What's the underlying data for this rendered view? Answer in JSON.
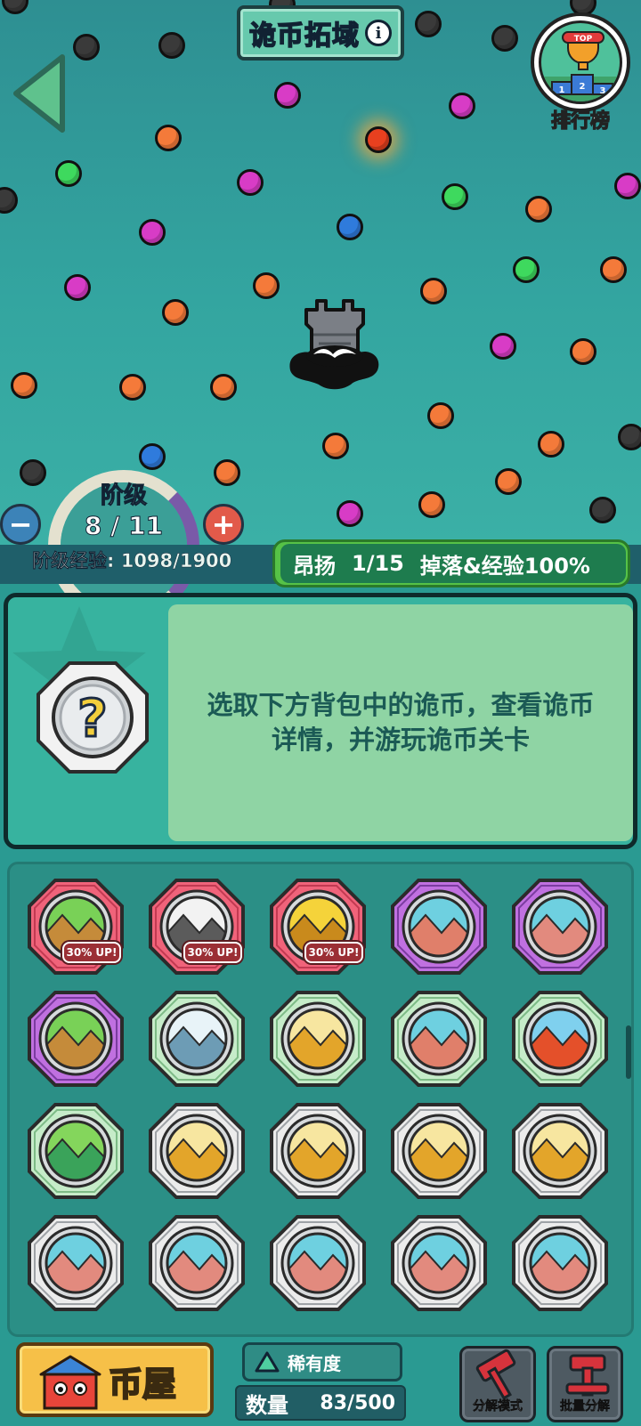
{
  "header": {
    "title": "诡币拓域",
    "info_icon": "info-icon"
  },
  "leaderboard": {
    "label": "排行榜",
    "badge_text": "TOP",
    "podium": [
      "1",
      "2",
      "3"
    ]
  },
  "stage": {
    "label": "阶级",
    "value": "8 / 11",
    "current": 8,
    "max": 11
  },
  "experience": {
    "text": "阶级经验: 1098/1900"
  },
  "status": {
    "name": "昂扬",
    "progress": "1/15",
    "bonus": "掉落&经验100%"
  },
  "detail": {
    "hint": "选取下方背包中的诡币，查看诡币详情，并游玩诡币关卡"
  },
  "inventory": {
    "up_tag": "30% UP!",
    "coins": [
      {
        "frame": "red",
        "theme": "scarecrow",
        "tag": true
      },
      {
        "frame": "red",
        "theme": "snow-pylon",
        "tag": true
      },
      {
        "frame": "red",
        "theme": "temple-gold",
        "tag": true
      },
      {
        "frame": "purple",
        "theme": "castle-tower",
        "tag": false
      },
      {
        "frame": "purple",
        "theme": "wall-ruins",
        "tag": false
      },
      {
        "frame": "purple",
        "theme": "scarecrow",
        "tag": false
      },
      {
        "frame": "green",
        "theme": "snow-mountain",
        "tag": false
      },
      {
        "frame": "green",
        "theme": "pyramids",
        "tag": false
      },
      {
        "frame": "green",
        "theme": "castle-tower",
        "tag": false
      },
      {
        "frame": "green",
        "theme": "volcano",
        "tag": false
      },
      {
        "frame": "green",
        "theme": "harvester",
        "tag": false
      },
      {
        "frame": "grey",
        "theme": "pyramids",
        "tag": false
      },
      {
        "frame": "grey",
        "theme": "pyramids",
        "tag": false
      },
      {
        "frame": "grey",
        "theme": "pyramids",
        "tag": false
      },
      {
        "frame": "grey",
        "theme": "pyramids",
        "tag": false
      },
      {
        "frame": "grey",
        "theme": "wall-ruins",
        "tag": false
      },
      {
        "frame": "grey",
        "theme": "wall-ruins",
        "tag": false
      },
      {
        "frame": "grey",
        "theme": "wall-ruins",
        "tag": false
      },
      {
        "frame": "grey",
        "theme": "wall-ruins",
        "tag": false
      },
      {
        "frame": "grey",
        "theme": "wall-ruins",
        "tag": false
      }
    ]
  },
  "bottom": {
    "coin_house": "币屋",
    "rarity": "稀有度",
    "quantity_label": "数量",
    "quantity_value": "83/500",
    "decompose_mode": "分解模式",
    "batch_decompose": "批量分解"
  },
  "colors": {
    "field_bg": "#33a5a0",
    "frame_red": "#f0637a",
    "frame_purple": "#c070e0",
    "frame_green": "#bfe8c4",
    "frame_grey": "#e4e4e4",
    "status_green": "#56c247"
  }
}
